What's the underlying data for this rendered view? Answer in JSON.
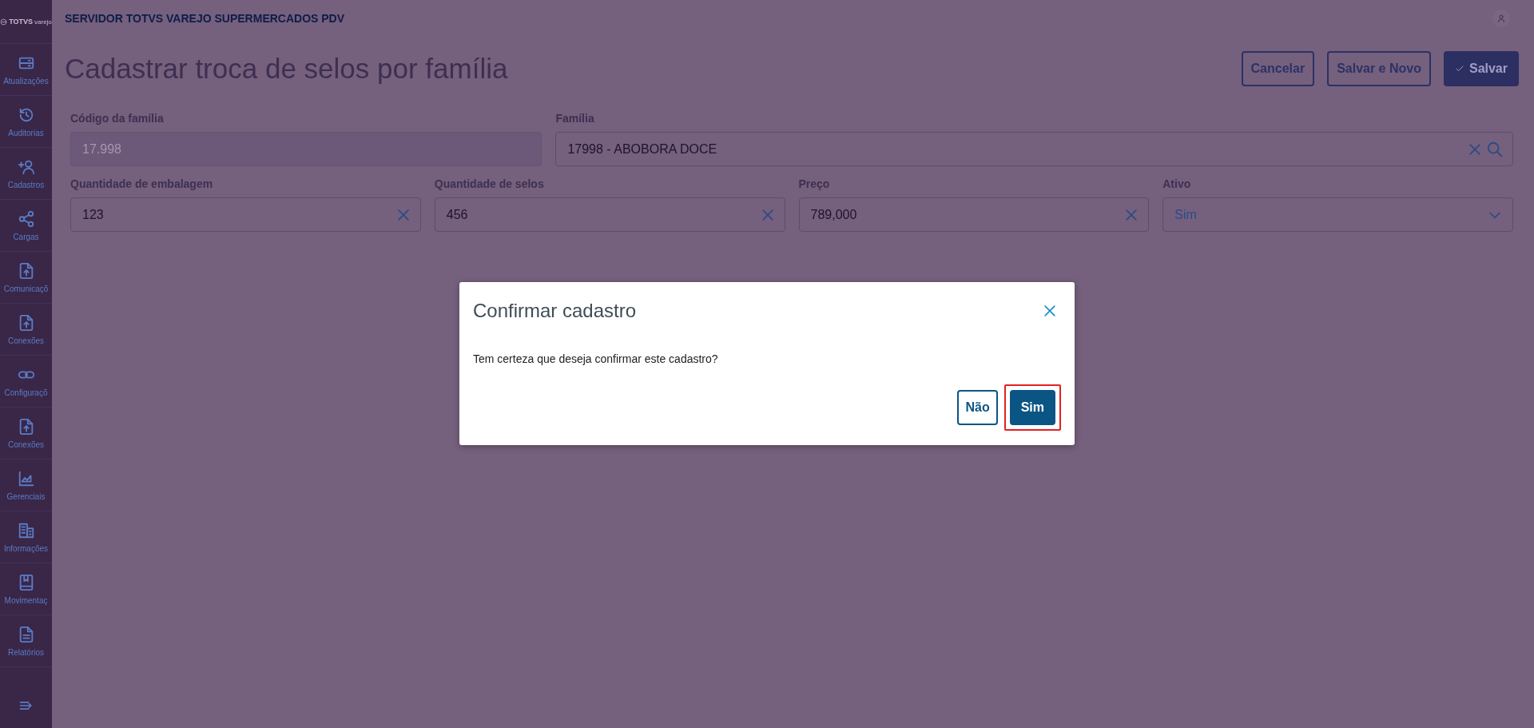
{
  "sidebar": {
    "logo": "TOTVS",
    "logo_sub": "varejo",
    "items": [
      {
        "label": "Atualizações"
      },
      {
        "label": "Auditorias"
      },
      {
        "label": "Cadastros"
      },
      {
        "label": "Cargas"
      },
      {
        "label": "Comunicaçõ"
      },
      {
        "label": "Conexões"
      },
      {
        "label": "Configuraçõ"
      },
      {
        "label": "Conexões"
      },
      {
        "label": "Gerenciais"
      },
      {
        "label": "Informações"
      },
      {
        "label": "Movimentaç"
      },
      {
        "label": "Relatórios"
      }
    ]
  },
  "header": {
    "title": "SERVIDOR TOTVS VAREJO SUPERMERCADOS PDV"
  },
  "page": {
    "title": "Cadastrar troca de selos por família",
    "actions": [
      {
        "label": "Cancelar",
        "kind": "outline"
      },
      {
        "label": "Salvar e Novo",
        "kind": "outline"
      },
      {
        "label": "Salvar",
        "kind": "primary"
      }
    ]
  },
  "form": {
    "rows": [
      [
        {
          "label": "Código da família",
          "value": "17.998",
          "kind": "text",
          "disabled": true
        },
        {
          "label": "Família",
          "value": "17998 - ABOBORA DOCE",
          "kind": "lookup",
          "disabled": false
        }
      ],
      [
        {
          "label": "Quantidade de embalagem",
          "value": "123",
          "kind": "text",
          "disabled": false
        },
        {
          "label": "Quantidade de selos",
          "value": "456",
          "kind": "text",
          "disabled": false
        },
        {
          "label": "Preço",
          "value": "789,000",
          "kind": "text",
          "disabled": false
        },
        {
          "label": "Ativo",
          "value": "Sim",
          "kind": "select",
          "disabled": false
        }
      ]
    ]
  },
  "dialog": {
    "title": "Confirmar cadastro",
    "message": "Tem certeza que deseja confirmar este cadastro?",
    "buttons": [
      {
        "label": "Não",
        "kind": "outline",
        "highlighted": false
      },
      {
        "label": "Sim",
        "kind": "primary",
        "highlighted": true
      }
    ]
  }
}
